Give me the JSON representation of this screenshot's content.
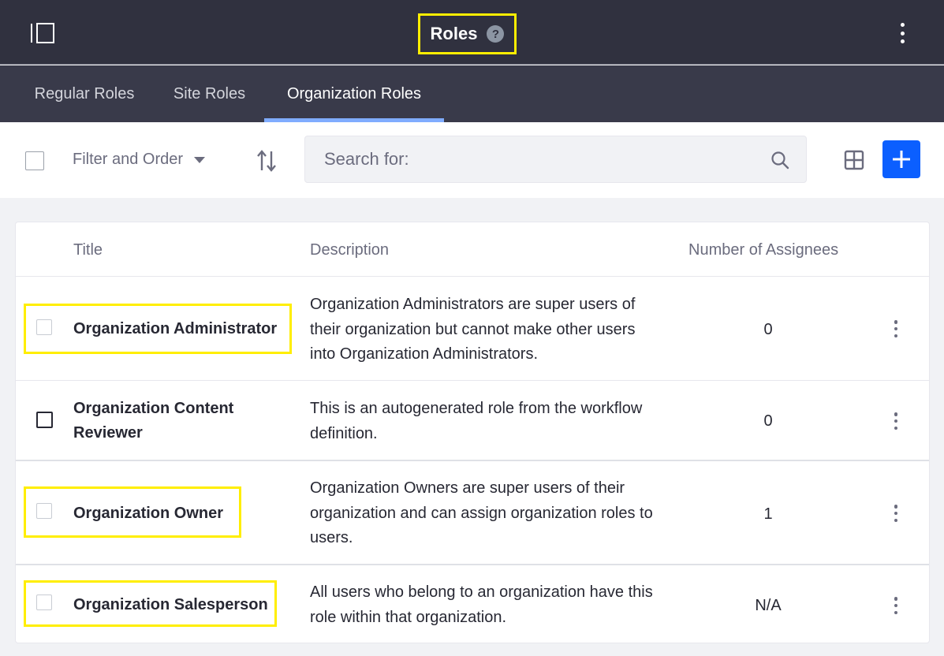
{
  "header": {
    "title": "Roles",
    "help_glyph": "?",
    "icons": [
      "sidebar-toggle-icon",
      "help-icon",
      "kebab-menu-icon"
    ]
  },
  "tabs": [
    {
      "label": "Regular Roles",
      "active": false
    },
    {
      "label": "Site Roles",
      "active": false
    },
    {
      "label": "Organization Roles",
      "active": true
    }
  ],
  "toolbar": {
    "filter_label": "Filter and Order",
    "search_placeholder": "Search for:",
    "search_value": "",
    "icons": [
      "order-arrows-icon",
      "search-icon",
      "grid-view-icon",
      "plus-icon"
    ]
  },
  "table": {
    "columns": [
      "Title",
      "Description",
      "Number of Assignees"
    ],
    "rows": [
      {
        "title": "Organization Administrator",
        "description": "Organization Administrators are super users of their organization but cannot make other users into Organization Administrators.",
        "assignees": "0",
        "highlighted": true
      },
      {
        "title": "Organization Content Reviewer",
        "description": "This is an autogenerated role from the workflow definition.",
        "assignees": "0",
        "highlighted": false
      },
      {
        "title": "Organization Owner",
        "description": "Organization Owners are super users of their organization and can assign organization roles to users.",
        "assignees": "1",
        "highlighted": true
      },
      {
        "title": "Organization Salesperson",
        "description": "All users who belong to an organization have this role within that organization.",
        "assignees": "N/A",
        "highlighted": true
      }
    ]
  },
  "colors": {
    "header_bg": "#30313f",
    "tabbar_bg": "#393a4a",
    "active_tab_indicator": "#80acff",
    "primary_button": "#0b5fff",
    "highlight": "#ffee00"
  }
}
